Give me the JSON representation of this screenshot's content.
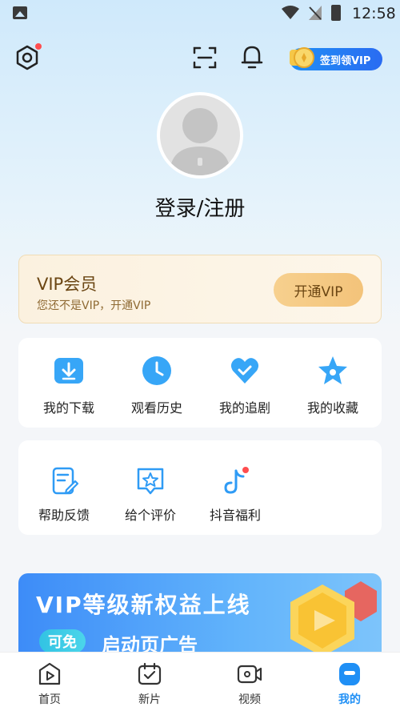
{
  "status_bar": {
    "time": "12:58"
  },
  "toolbar": {
    "signin_label": "签到领VIP"
  },
  "profile": {
    "login_label": "登录/注册"
  },
  "vip_card": {
    "title": "VIP会员",
    "subtitle": "您还不是VIP，开通VIP",
    "button_label": "开通VIP"
  },
  "quick_actions": [
    {
      "label": "我的下载",
      "icon": "download-icon"
    },
    {
      "label": "观看历史",
      "icon": "clock-icon"
    },
    {
      "label": "我的追剧",
      "icon": "heart-check-icon"
    },
    {
      "label": "我的收藏",
      "icon": "star-icon"
    }
  ],
  "services": [
    {
      "label": "帮助反馈",
      "icon": "feedback-doc-icon"
    },
    {
      "label": "给个评价",
      "icon": "rating-star-icon"
    },
    {
      "label": "抖音福利",
      "icon": "tiktok-icon"
    }
  ],
  "banner": {
    "title": "VIP等级新权益上线",
    "badge": "可免",
    "subtitle": "启动页广告"
  },
  "bottom_nav": [
    {
      "label": "首页",
      "icon": "home-play-icon",
      "active": false
    },
    {
      "label": "新片",
      "icon": "calendar-check-icon",
      "active": false
    },
    {
      "label": "视频",
      "icon": "video-camera-icon",
      "active": false
    },
    {
      "label": "我的",
      "icon": "user-icon",
      "active": true
    }
  ],
  "colors": {
    "accent": "#1f8ff5",
    "vip_gold": "#f3c37a",
    "vip_text": "#6b4613",
    "notification_dot": "#ff4d4f"
  }
}
